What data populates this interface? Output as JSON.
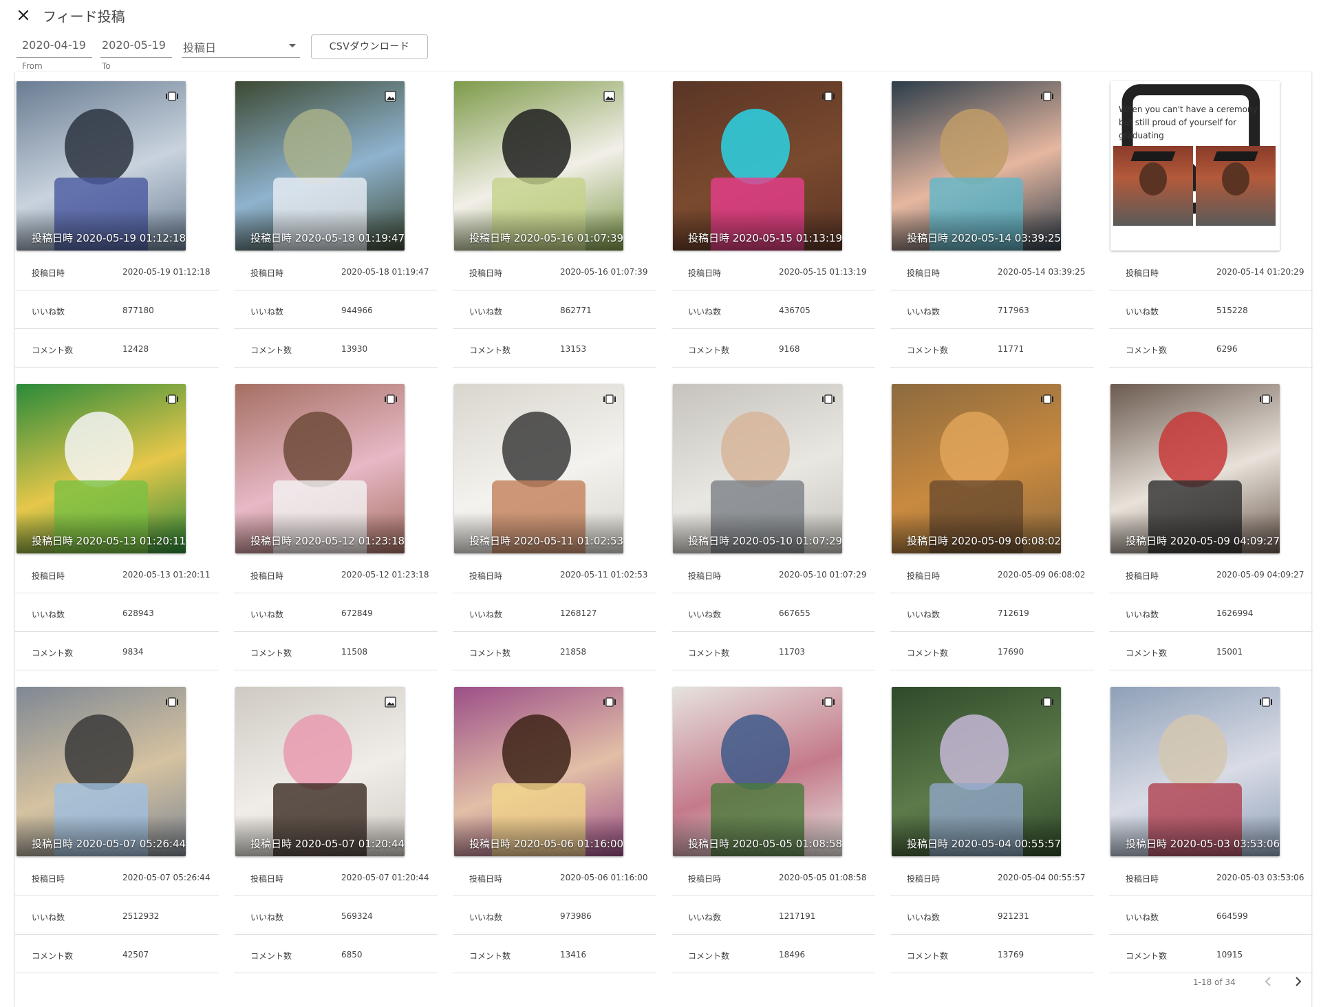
{
  "header": {
    "title": "フィード投稿"
  },
  "filters": {
    "from_value": "2020-04-19",
    "from_label": "From",
    "to_value": "2020-05-19",
    "to_label": "To",
    "sort_value": "投稿日",
    "csv_label": "CSVダウンロード"
  },
  "field_labels": {
    "date": "投稿日時",
    "likes": "いいね数",
    "comments": "コメント数"
  },
  "posts": [
    {
      "stamp": "投稿日時 2020-05-19 01:12:18",
      "date": "2020-05-19 01:12:18",
      "likes": "877180",
      "comments": "12428",
      "kind": "video-icon"
    },
    {
      "stamp": "投稿日時 2020-05-18 01:19:47",
      "date": "2020-05-18 01:19:47",
      "likes": "944966",
      "comments": "13930",
      "kind": "image-icon"
    },
    {
      "stamp": "投稿日時 2020-05-16 01:07:39",
      "date": "2020-05-16 01:07:39",
      "likes": "862771",
      "comments": "13153",
      "kind": "image-icon"
    },
    {
      "stamp": "投稿日時 2020-05-15 01:13:19",
      "date": "2020-05-15 01:13:19",
      "likes": "436705",
      "comments": "9168",
      "kind": "video-icon"
    },
    {
      "stamp": "投稿日時 2020-05-14 03:39:25",
      "date": "2020-05-14 03:39:25",
      "likes": "717963",
      "comments": "11771",
      "kind": "video-icon"
    },
    {
      "stamp": "",
      "date": "2020-05-14 01:20:29",
      "likes": "515228",
      "comments": "6296",
      "kind": "image-icon",
      "caption": "When you can't have a ceremony but still proud of yourself for graduating"
    },
    {
      "stamp": "投稿日時 2020-05-13 01:20:11",
      "date": "2020-05-13 01:20:11",
      "likes": "628943",
      "comments": "9834",
      "kind": "video-icon"
    },
    {
      "stamp": "投稿日時 2020-05-12 01:23:18",
      "date": "2020-05-12 01:23:18",
      "likes": "672849",
      "comments": "11508",
      "kind": "video-icon"
    },
    {
      "stamp": "投稿日時 2020-05-11 01:02:53",
      "date": "2020-05-11 01:02:53",
      "likes": "1268127",
      "comments": "21858",
      "kind": "video-icon"
    },
    {
      "stamp": "投稿日時 2020-05-10 01:07:29",
      "date": "2020-05-10 01:07:29",
      "likes": "667655",
      "comments": "11703",
      "kind": "video-icon"
    },
    {
      "stamp": "投稿日時 2020-05-09 06:08:02",
      "date": "2020-05-09 06:08:02",
      "likes": "712619",
      "comments": "17690",
      "kind": "video-icon"
    },
    {
      "stamp": "投稿日時 2020-05-09 04:09:27",
      "date": "2020-05-09 04:09:27",
      "likes": "1626994",
      "comments": "15001",
      "kind": "video-icon"
    },
    {
      "stamp": "投稿日時 2020-05-07 05:26:44",
      "date": "2020-05-07 05:26:44",
      "likes": "2512932",
      "comments": "42507",
      "kind": "video-icon"
    },
    {
      "stamp": "投稿日時 2020-05-07 01:20:44",
      "date": "2020-05-07 01:20:44",
      "likes": "569324",
      "comments": "6850",
      "kind": "image-icon"
    },
    {
      "stamp": "投稿日時 2020-05-06 01:16:00",
      "date": "2020-05-06 01:16:00",
      "likes": "973986",
      "comments": "13416",
      "kind": "video-icon"
    },
    {
      "stamp": "投稿日時 2020-05-05 01:08:58",
      "date": "2020-05-05 01:08:58",
      "likes": "1217191",
      "comments": "18496",
      "kind": "video-icon"
    },
    {
      "stamp": "投稿日時 2020-05-04 00:55:57",
      "date": "2020-05-04 00:55:57",
      "likes": "921231",
      "comments": "13769",
      "kind": "video-icon"
    },
    {
      "stamp": "投稿日時 2020-05-03 03:53:06",
      "date": "2020-05-03 03:53:06",
      "likes": "664599",
      "comments": "10915",
      "kind": "video-icon"
    }
  ],
  "pagination": {
    "range": "1-18 of 34"
  }
}
